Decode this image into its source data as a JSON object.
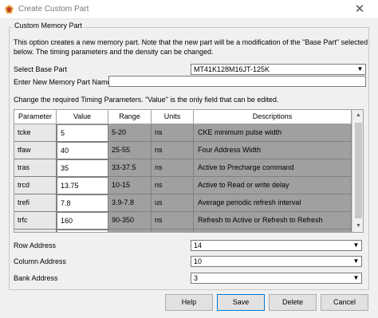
{
  "window": {
    "title": "Create Custom Part",
    "close_glyph": "✕"
  },
  "group": {
    "label": "Custom Memory Part",
    "description": "This option creates a new memory part. Note that the new part will be a modification of the \"Base Part\" selected below. The timing parameters and the density can be changed."
  },
  "base_part": {
    "label": "Select Base Part",
    "value": "MT41K128M16JT-125K"
  },
  "new_part": {
    "label": "Enter New Memory Part Name",
    "value": ""
  },
  "timing": {
    "instruction": "Change the required Timing Parameters. \"Value\" is the only field that can be edited.",
    "columns": [
      "Parameter",
      "Value",
      "Range",
      "Units",
      "Descriptions"
    ],
    "rows": [
      {
        "param": "tcke",
        "value": "5",
        "range": "5-20",
        "units": "ns",
        "desc": "CKE minimum pulse width"
      },
      {
        "param": "tfaw",
        "value": "40",
        "range": "25-55",
        "units": "ns",
        "desc": "Four Address Width"
      },
      {
        "param": "tras",
        "value": "35",
        "range": "33-37.5",
        "units": "ns",
        "desc": "Active to Precharge command"
      },
      {
        "param": "trcd",
        "value": "13.75",
        "range": "10-15",
        "units": "ns",
        "desc": "Active to Read or write delay"
      },
      {
        "param": "trefi",
        "value": "7.8",
        "range": "3.9-7.8",
        "units": "us",
        "desc": "Average periodic refresh interval"
      },
      {
        "param": "trfc",
        "value": "160",
        "range": "90-350",
        "units": "ns",
        "desc": "Refresh to Active or Refresh to Refresh"
      },
      {
        "param": "",
        "value": "",
        "range": "",
        "units": "",
        "desc": ""
      }
    ]
  },
  "row_address": {
    "label": "Row Address",
    "value": "14"
  },
  "column_address": {
    "label": "Column Address",
    "value": "10"
  },
  "bank_address": {
    "label": "Bank Address",
    "value": "3"
  },
  "buttons": {
    "help": "Help",
    "save": "Save",
    "delete": "Delete",
    "cancel": "Cancel"
  },
  "colors": {
    "grid_bg": "#a0a0a0",
    "window_bg": "#f0f0f0",
    "focus_border": "#0078d7"
  }
}
